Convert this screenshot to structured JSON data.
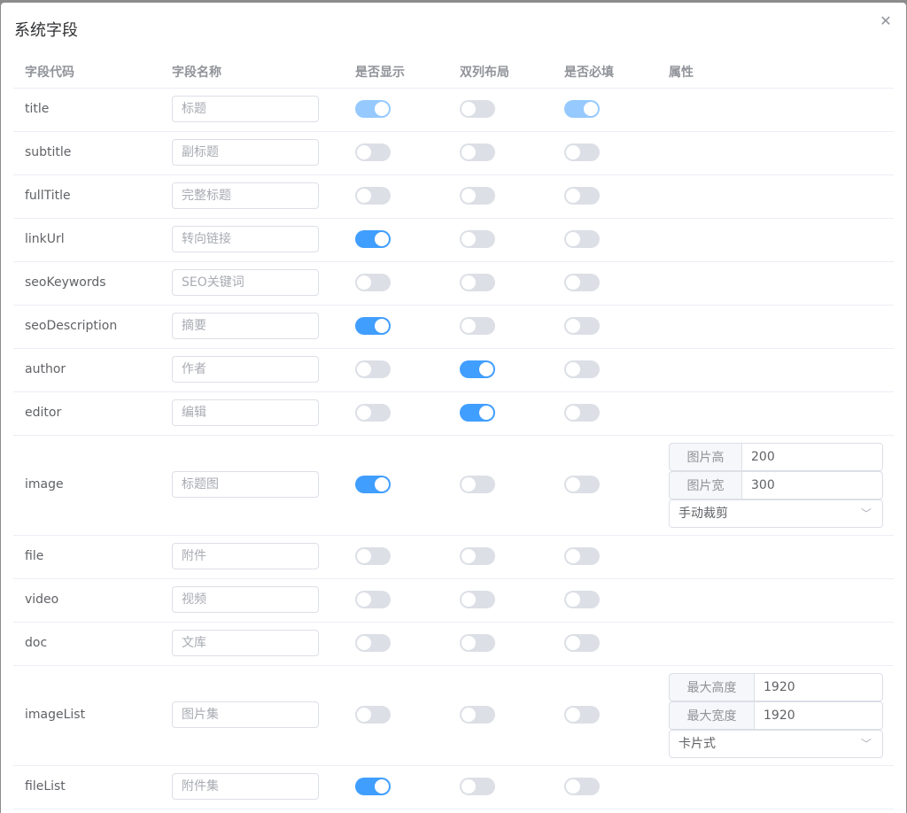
{
  "dialog": {
    "title": "系统字段",
    "close_icon": "close-icon"
  },
  "headers": [
    "字段代码",
    "字段名称",
    "是否显示",
    "双列布局",
    "是否必填",
    "属性"
  ],
  "rows": [
    {
      "code": "title",
      "name": "标题",
      "show": true,
      "double": false,
      "required": true,
      "disabled": true
    },
    {
      "code": "subtitle",
      "name": "副标题",
      "show": false,
      "double": false,
      "required": false
    },
    {
      "code": "fullTitle",
      "name": "完整标题",
      "show": false,
      "double": false,
      "required": false
    },
    {
      "code": "linkUrl",
      "name": "转向链接",
      "show": true,
      "double": false,
      "required": false
    },
    {
      "code": "seoKeywords",
      "name": "SEO关键词",
      "show": false,
      "double": false,
      "required": false
    },
    {
      "code": "seoDescription",
      "name": "摘要",
      "show": true,
      "double": false,
      "required": false
    },
    {
      "code": "author",
      "name": "作者",
      "show": false,
      "double": true,
      "required": false
    },
    {
      "code": "editor",
      "name": "编辑",
      "show": false,
      "double": true,
      "required": false
    },
    {
      "code": "image",
      "name": "标题图",
      "show": true,
      "double": false,
      "required": false,
      "attrs": {
        "field1_label": "图片高",
        "field1_value": "200",
        "field2_label": "图片宽",
        "field2_value": "300",
        "select_value": "手动裁剪"
      }
    },
    {
      "code": "file",
      "name": "附件",
      "show": false,
      "double": false,
      "required": false
    },
    {
      "code": "video",
      "name": "视频",
      "show": false,
      "double": false,
      "required": false
    },
    {
      "code": "doc",
      "name": "文库",
      "show": false,
      "double": false,
      "required": false
    },
    {
      "code": "imageList",
      "name": "图片集",
      "show": false,
      "double": false,
      "required": false,
      "attrs": {
        "field1_label": "最大高度",
        "field1_value": "1920",
        "field2_label": "最大宽度",
        "field2_value": "1920",
        "select_value": "卡片式"
      }
    },
    {
      "code": "fileList",
      "name": "附件集",
      "show": true,
      "double": false,
      "required": false
    }
  ],
  "colors": {
    "switch_on": "#409eff",
    "switch_off": "#dcdfe6",
    "border": "#ebeef5"
  }
}
